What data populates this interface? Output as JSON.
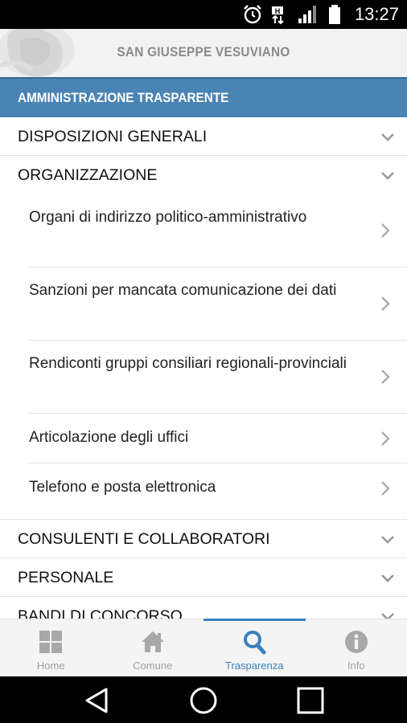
{
  "status_bar": {
    "time": "13:27",
    "icons": [
      "alarm-icon",
      "data-up-down-icon",
      "signal-icon",
      "battery-icon"
    ]
  },
  "header": {
    "title": "SAN GIUSEPPE VESUVIANO",
    "emblem": "municipal-emblem"
  },
  "section": {
    "title": "AMMINISTRAZIONE TRASPARENTE"
  },
  "categories": [
    {
      "label": "DISPOSIZIONI GENERALI",
      "expanded": false
    },
    {
      "label": "ORGANIZZAZIONE",
      "expanded": true,
      "items": [
        {
          "label": "Organi di indirizzo politico-amministrativo"
        },
        {
          "label": "Sanzioni per mancata comunicazione dei dati"
        },
        {
          "label": "Rendiconti gruppi consiliari regionali-provinciali"
        },
        {
          "label": "Articolazione degli uffici"
        },
        {
          "label": "Telefono e posta elettronica"
        }
      ]
    },
    {
      "label": "CONSULENTI E COLLABORATORI",
      "expanded": false
    },
    {
      "label": "PERSONALE",
      "expanded": false
    },
    {
      "label": "BANDI DI CONCORSO",
      "expanded": false
    }
  ],
  "bottom_nav": {
    "tabs": [
      {
        "label": "Home",
        "icon": "grid-icon"
      },
      {
        "label": "Comune",
        "icon": "home-icon"
      },
      {
        "label": "Trasparenza",
        "icon": "search-icon",
        "active": true
      },
      {
        "label": "Info",
        "icon": "info-icon"
      }
    ]
  },
  "colors": {
    "section_bar": "#4a84b4",
    "active_tab": "#3a7fc0",
    "inactive_tab": "#a0a0a0"
  }
}
